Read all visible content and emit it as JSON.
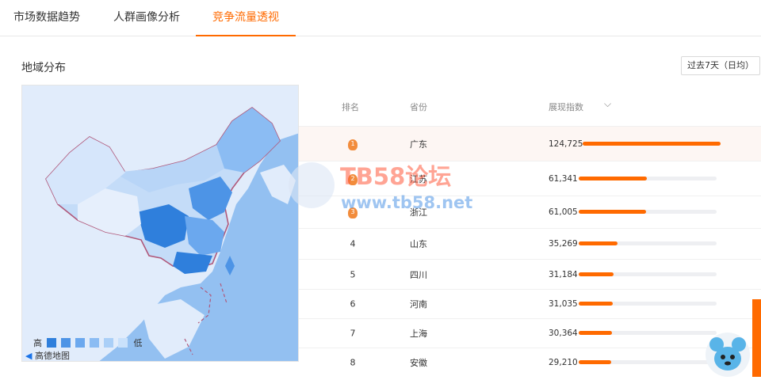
{
  "tabs": [
    "市场数据趋势",
    "人群画像分析",
    "竞争流量透视"
  ],
  "active_tab": 2,
  "section_title": "地域分布",
  "period_select": "过去7天（日均）",
  "map": {
    "legend_high": "高",
    "legend_low": "低",
    "legend_colors": [
      "#2f7fdc",
      "#4d94e6",
      "#6ba8ee",
      "#8bbcf3",
      "#aacff7",
      "#c9e1fb"
    ],
    "logo_text": "高德地图",
    "sea_color": "#93c0f1",
    "land_color": "#e1ecfb",
    "border_color": "#b0587a"
  },
  "table": {
    "headers": {
      "rank": "排名",
      "province": "省份",
      "value": "展现指数"
    },
    "max_value": 124725,
    "rows": [
      {
        "rank": "1",
        "province": "广东",
        "value": "124,725",
        "num": 124725,
        "medal": true
      },
      {
        "rank": "2",
        "province": "江苏",
        "value": "61,341",
        "num": 61341,
        "medal": true
      },
      {
        "rank": "3",
        "province": "浙江",
        "value": "61,005",
        "num": 61005,
        "medal": true
      },
      {
        "rank": "4",
        "province": "山东",
        "value": "35,269",
        "num": 35269,
        "medal": false
      },
      {
        "rank": "5",
        "province": "四川",
        "value": "31,184",
        "num": 31184,
        "medal": false
      },
      {
        "rank": "6",
        "province": "河南",
        "value": "31,035",
        "num": 31035,
        "medal": false
      },
      {
        "rank": "7",
        "province": "上海",
        "value": "30,364",
        "num": 30364,
        "medal": false
      },
      {
        "rank": "8",
        "province": "安徽",
        "value": "29,210",
        "num": 29210,
        "medal": false
      }
    ]
  },
  "watermark": {
    "line1": "TB58论坛",
    "line2": "www.tb58.net"
  },
  "accent": "#ff6a00"
}
